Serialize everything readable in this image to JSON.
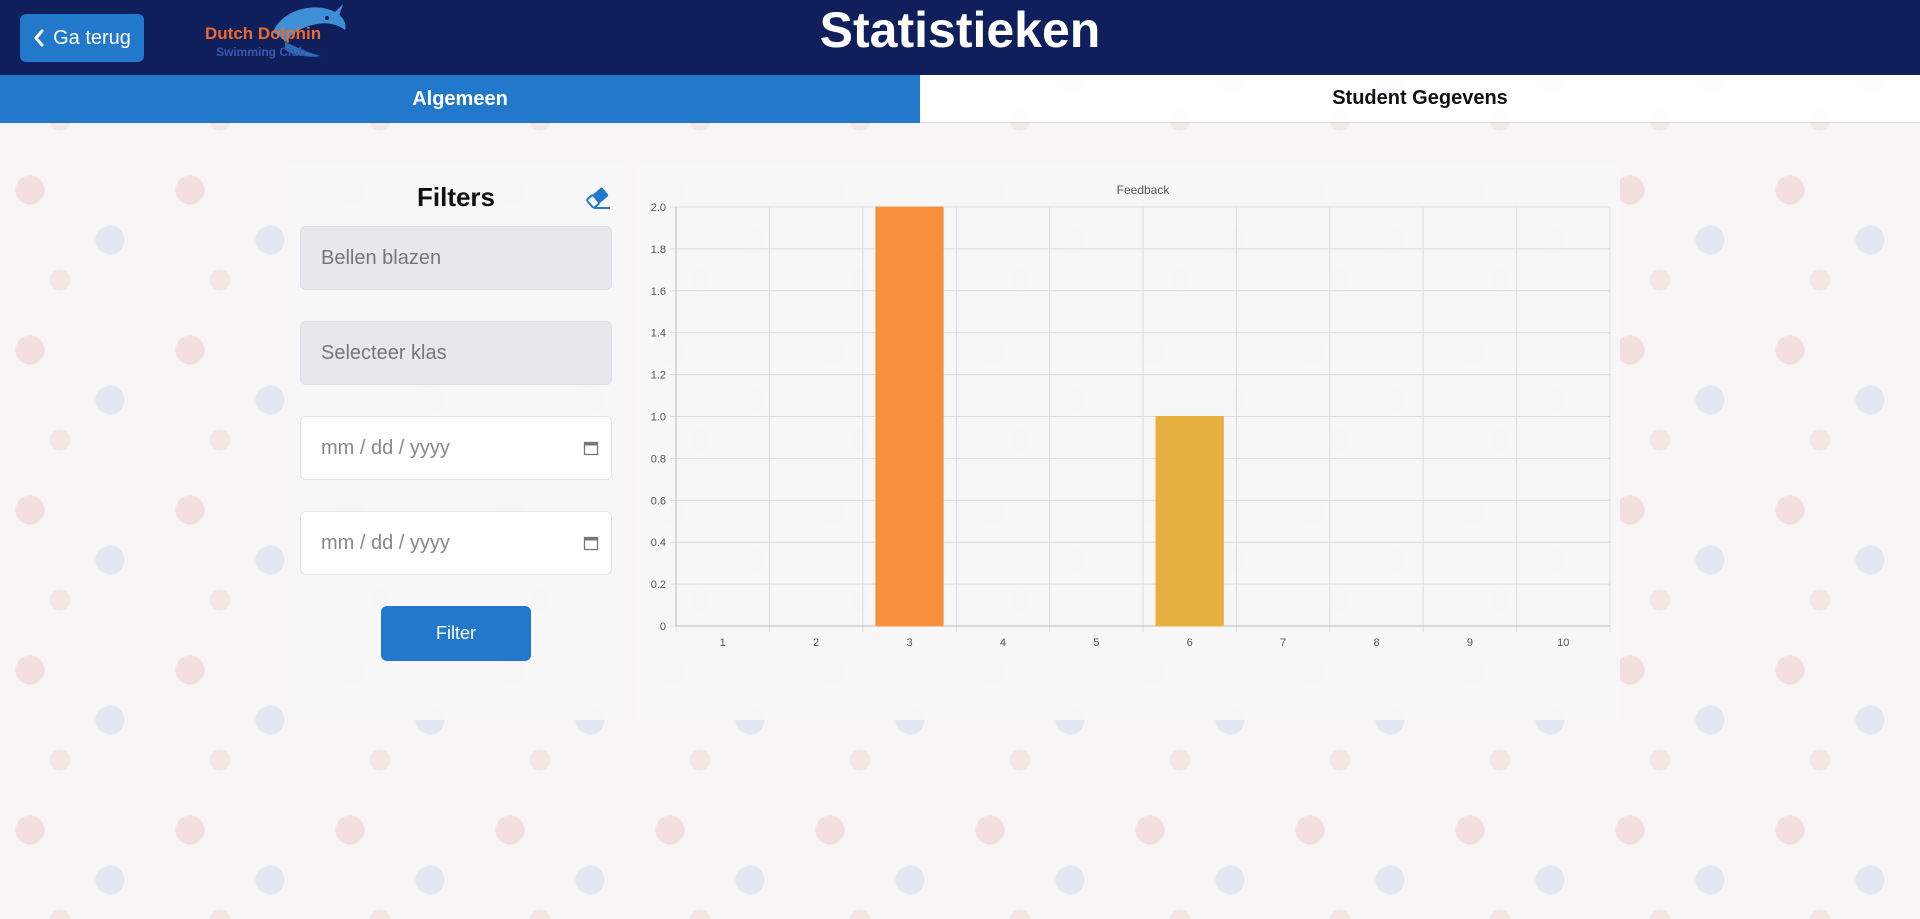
{
  "header": {
    "back_label": "Ga terug",
    "title": "Statistieken",
    "logo_line1": "Dutch Dolphin",
    "logo_line2": "Swimming Club"
  },
  "tabs": [
    {
      "label": "Algemeen",
      "active": true
    },
    {
      "label": "Student Gegevens",
      "active": false
    }
  ],
  "filters": {
    "title": "Filters",
    "exercise_placeholder": "Bellen blazen",
    "class_placeholder": "Selecteer klas",
    "start_date_placeholder": "mm / dd / yyyy",
    "end_date_placeholder": "mm / dd / yyyy",
    "submit_label": "Filter"
  },
  "colors": {
    "header_bg": "#0e1f5b",
    "accent": "#2279cc",
    "bar_orange": "#f7913e",
    "bar_gold": "#e6b13e"
  },
  "chart_data": {
    "type": "bar",
    "title": "Feedback",
    "categories": [
      "1",
      "2",
      "3",
      "4",
      "5",
      "6",
      "7",
      "8",
      "9",
      "10"
    ],
    "values": [
      0,
      0,
      2,
      0,
      0,
      1,
      0,
      0,
      0,
      0
    ],
    "bar_colors": [
      "#f7913e",
      "#f7913e",
      "#f7913e",
      "#f7913e",
      "#f7913e",
      "#e6b13e",
      "#f7913e",
      "#f7913e",
      "#f7913e",
      "#f7913e"
    ],
    "ylim": [
      0,
      2
    ],
    "yticks": [
      "0",
      "0.2",
      "0.4",
      "0.6",
      "0.8",
      "1.0",
      "1.2",
      "1.4",
      "1.6",
      "1.8",
      "2.0"
    ],
    "grid": true,
    "legend": "none"
  }
}
